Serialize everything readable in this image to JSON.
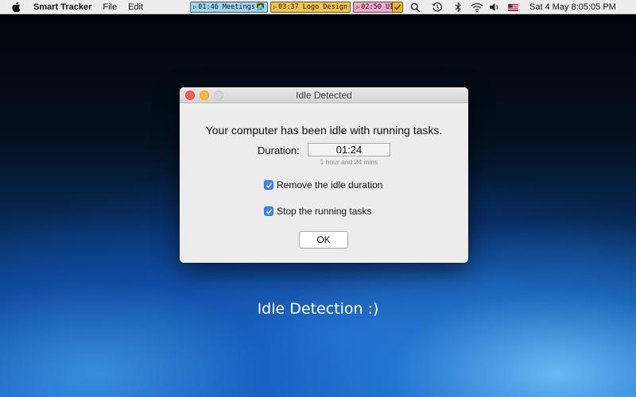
{
  "menubar": {
    "app_name": "Smart Tracker",
    "menus": [
      "File",
      "Edit"
    ],
    "timers": [
      {
        "play": "▷",
        "text": "01:46 Meetings",
        "emoji": "👩‍💻",
        "color": "#9fd4f0"
      },
      {
        "play": "▷",
        "text": "03:37 Logo Design",
        "color": "#f5c542"
      },
      {
        "play": "▷",
        "text": "02:50 UI",
        "color": "#f2a6c8"
      }
    ],
    "clock": "Sat 4 May  8:05:05 PM",
    "icons": [
      "apple-icon",
      "check-icon",
      "search-icon",
      "time-machine-icon",
      "bluetooth-icon",
      "wifi-icon",
      "volume-icon",
      "flag-icon"
    ]
  },
  "dialog": {
    "title": "Idle Detected",
    "message": "Your computer has been idle with running tasks.",
    "duration_label": "Duration:",
    "duration_value": "01:24",
    "duration_sub": "1 hour and 24 mins",
    "options": [
      {
        "label": "Remove the idle duration",
        "checked": true
      },
      {
        "label": "Stop the running tasks",
        "checked": true
      }
    ],
    "ok_label": "OK"
  },
  "caption": "Idle Detection :)",
  "colors": {
    "checkbox": "#3d85f3",
    "close": "#fc605c",
    "minimize": "#fdbc40"
  }
}
